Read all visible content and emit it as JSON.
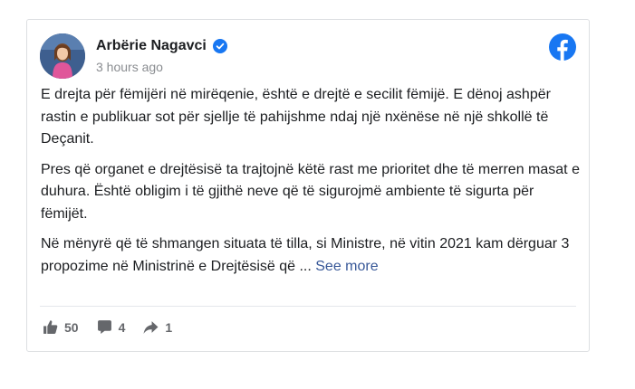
{
  "post": {
    "author": "Arbërie Nagavci",
    "time": "3 hours ago",
    "paragraphs": [
      "E drejta për fëmijëri në mirëqenie, është e drejtë e secilit fëmijë. E dënoj ashpër rastin e publikuar sot për sjellje të pahijshme ndaj një nxënëse në një shkollë të Deçanit.",
      "Pres që organet e drejtësisë ta trajtojnë këtë rast me prioritet dhe të merren masat e duhura. Është obligim i të gjithë neve që të sigurojmë ambiente të sigurta për fëmijët.",
      "Në mënyrë që të shmangen situata të tilla, si Ministre, në vitin 2021 kam dërguar 3 propozime në Ministrinë e Drejtësisë që ..."
    ],
    "see_more": "See more"
  },
  "stats": {
    "likes": "50",
    "comments": "4",
    "shares": "1"
  },
  "icons": {
    "verified": "verified-badge-icon",
    "facebook": "facebook-logo-icon",
    "like": "thumbs-up-icon",
    "comment": "comment-icon",
    "share": "share-arrow-icon"
  },
  "colors": {
    "facebook_blue": "#1877f2",
    "link": "#385898",
    "muted": "#65676b"
  }
}
